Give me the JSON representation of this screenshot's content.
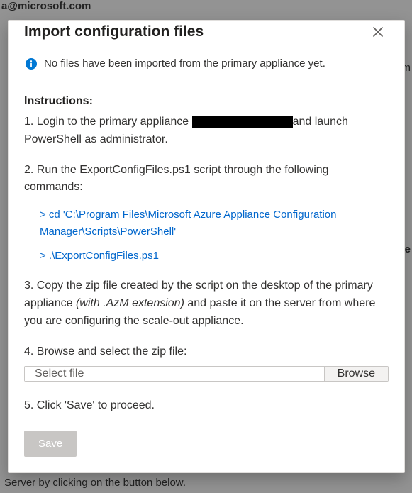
{
  "background": {
    "top_text": "a@microsoft.com",
    "right_text_1": "om",
    "right_text_2": "ne",
    "bottom_text": "Server by clicking on the button below."
  },
  "dialog": {
    "title": "Import configuration files",
    "info_text": "No files have been imported from the primary appliance yet.",
    "instructions_label": "Instructions:",
    "step1_a": "1. Login to the primary appliance ",
    "step1_b": "and launch PowerShell as administrator.",
    "step2": "2. Run the ExportConfigFiles.ps1 script through the following commands:",
    "cmd1": "> cd 'C:\\Program Files\\Microsoft Azure Appliance Configuration Manager\\Scripts\\PowerShell'",
    "cmd2": "> .\\ExportConfigFiles.ps1",
    "step3_a": "3. Copy the zip file created by the script on the desktop of the primary appliance ",
    "step3_b": "(with .AzM extension)",
    "step3_c": " and paste it on the server from where you are configuring the scale-out appliance.",
    "step4": "4. Browse and select the zip file:",
    "file_placeholder": "Select file",
    "browse_label": "Browse",
    "step5": "5. Click 'Save' to proceed.",
    "save_label": "Save"
  }
}
